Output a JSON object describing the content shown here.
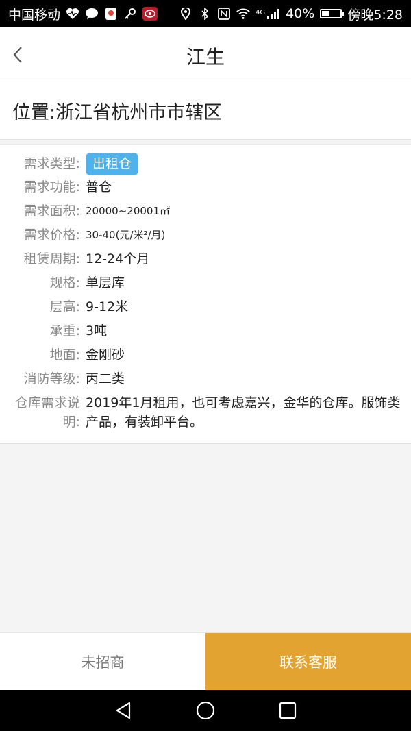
{
  "status_bar": {
    "carrier": "中国移动",
    "network": "4G",
    "battery": "40%",
    "battery_level": 0.4,
    "time": "傍晚5:28",
    "icons": [
      "heart-pulse-icon",
      "chat-bubble-icon",
      "map-pin-app-icon",
      "key-icon",
      "app-badge-icon",
      "location-icon",
      "bluetooth-icon",
      "nfc-icon",
      "wifi-icon",
      "signal-icon",
      "battery-icon"
    ]
  },
  "header": {
    "title": "江生",
    "back_icon": "chevron-left-icon"
  },
  "location": {
    "text": "位置:浙江省杭州市市辖区"
  },
  "details": {
    "type_label": "需求类型:",
    "type_tag": "出租仓",
    "tag_color": "#4fb2ea",
    "rows": [
      {
        "label": "需求功能:",
        "value": "普仓"
      },
      {
        "label": "需求面积:",
        "value": "20000~20001㎡"
      },
      {
        "label": "需求价格:",
        "value": "30-40(元/米²/月)"
      },
      {
        "label": "租赁周期:",
        "value": "12-24个月"
      },
      {
        "label": "规格:",
        "value": "单层库"
      },
      {
        "label": "层高:",
        "value": "9-12米"
      },
      {
        "label": "承重:",
        "value": "3吨"
      },
      {
        "label": "地面:",
        "value": "金刚砂"
      },
      {
        "label": "消防等级:",
        "value": "丙二类"
      }
    ],
    "description_label": "仓库需求说明:",
    "description": "2019年1月租用，也可考虑嘉兴，金华的仓库。服饰类产品，有装卸平台。"
  },
  "bottom_bar": {
    "left_label": "未招商",
    "right_label": "联系客服",
    "accent_color": "#e3a330"
  },
  "nav_bar": {
    "icons": [
      "back-triangle-icon",
      "home-circle-icon",
      "recent-square-icon"
    ]
  }
}
